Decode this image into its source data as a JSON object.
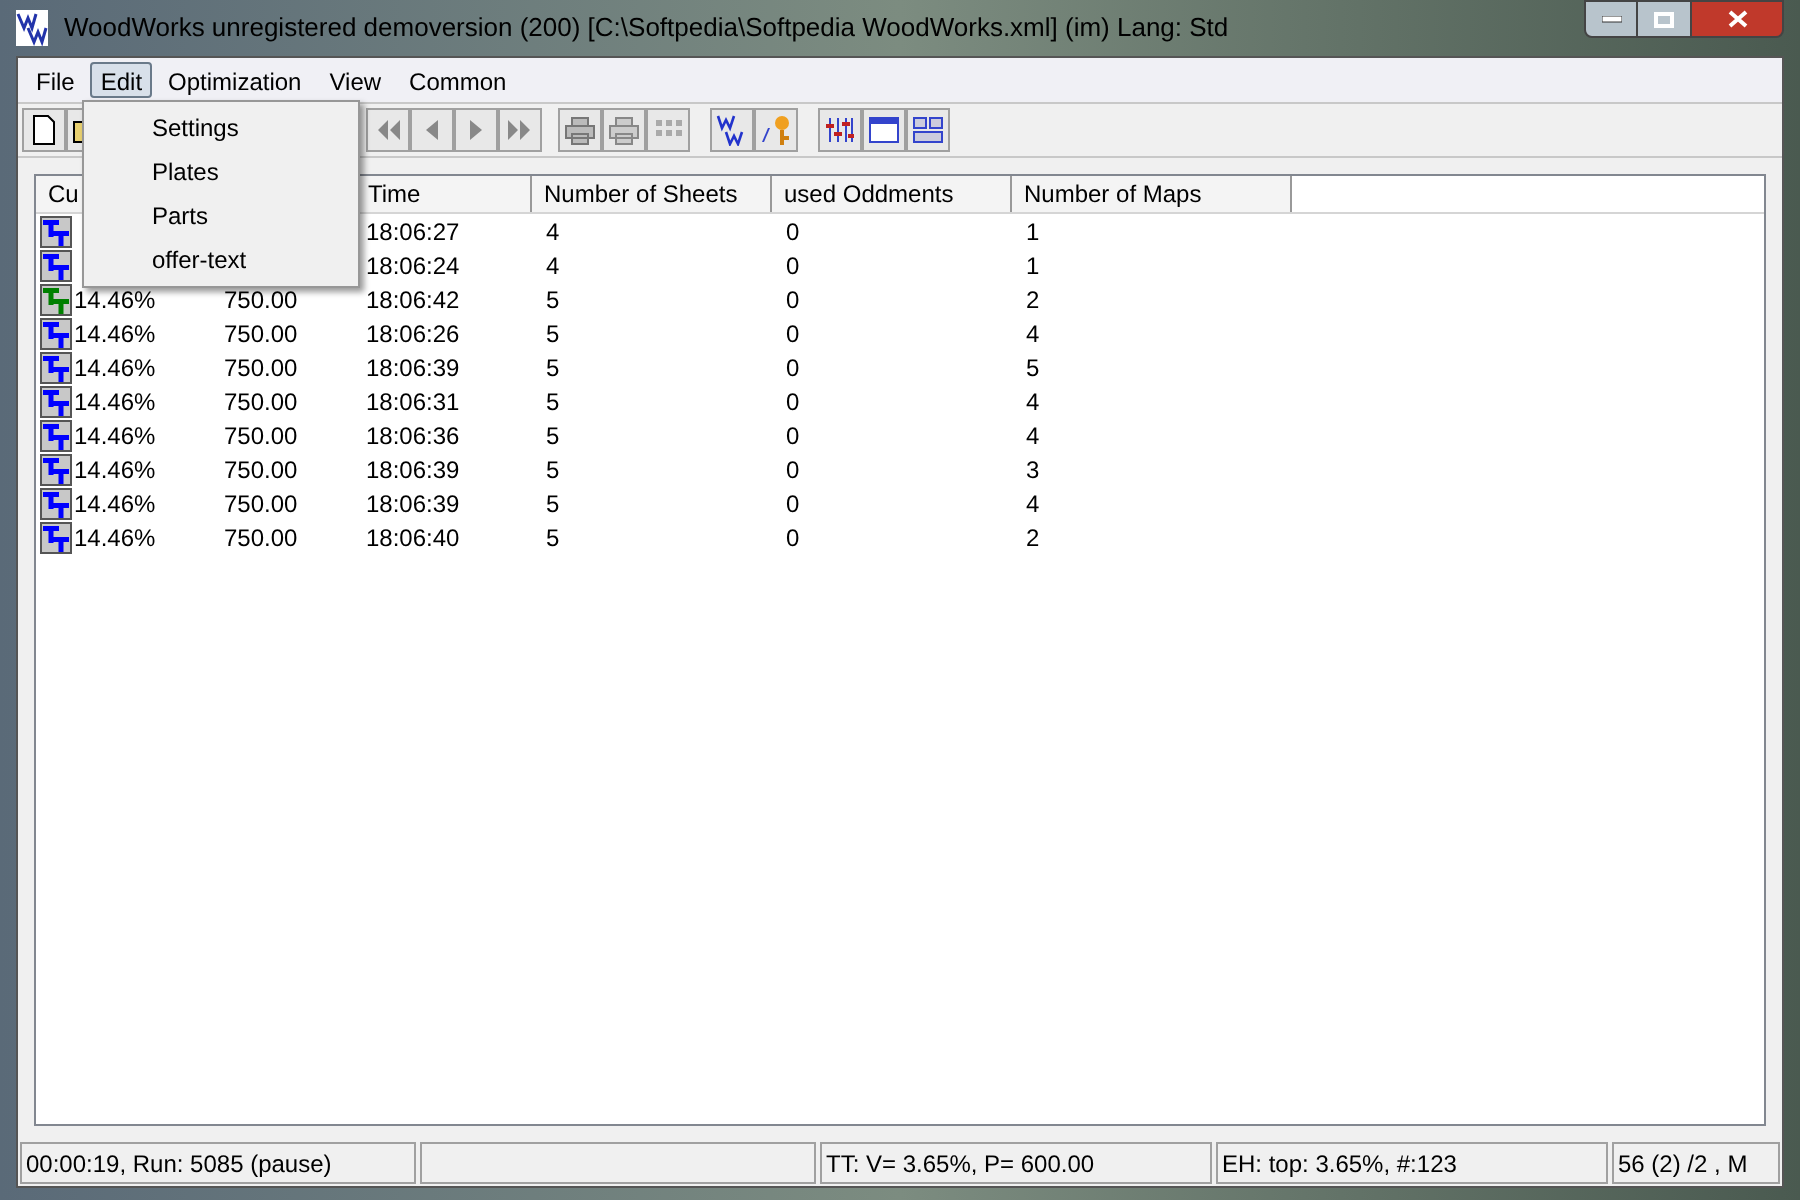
{
  "window": {
    "title": "WoodWorks unregistered demoversion (200) [C:\\Softpedia\\Softpedia WoodWorks.xml] (im) Lang: Std"
  },
  "menu": [
    {
      "label": "File",
      "selected": false
    },
    {
      "label": "Edit",
      "selected": true
    },
    {
      "label": "Optimization",
      "selected": false
    },
    {
      "label": "View",
      "selected": false
    },
    {
      "label": "Common",
      "selected": false
    }
  ],
  "dropdown": [
    "Settings",
    "Plates",
    "Parts",
    "offer-text"
  ],
  "table": {
    "columns": [
      {
        "label": "Cu"
      },
      {},
      {
        "label": "Time"
      },
      {
        "label": "Number of Sheets"
      },
      {
        "label": "used Oddments"
      },
      {
        "label": "Number of Maps"
      }
    ],
    "rows": [
      {
        "color": "#0000ff",
        "time": "18:06:27",
        "sheets": "4",
        "oddments": "0",
        "maps": "1"
      },
      {
        "color": "#0000ff",
        "time": "18:06:24",
        "sheets": "4",
        "oddments": "0",
        "maps": "1"
      },
      {
        "color": "#008000",
        "percent": "14.46%",
        "value": "750.00",
        "time": "18:06:42",
        "sheets": "5",
        "oddments": "0",
        "maps": "2"
      },
      {
        "color": "#0000ff",
        "percent": "14.46%",
        "value": "750.00",
        "time": "18:06:26",
        "sheets": "5",
        "oddments": "0",
        "maps": "4"
      },
      {
        "color": "#0000ff",
        "percent": "14.46%",
        "value": "750.00",
        "time": "18:06:39",
        "sheets": "5",
        "oddments": "0",
        "maps": "5"
      },
      {
        "color": "#0000ff",
        "percent": "14.46%",
        "value": "750.00",
        "time": "18:06:31",
        "sheets": "5",
        "oddments": "0",
        "maps": "4"
      },
      {
        "color": "#0000ff",
        "percent": "14.46%",
        "value": "750.00",
        "time": "18:06:36",
        "sheets": "5",
        "oddments": "0",
        "maps": "4"
      },
      {
        "color": "#0000ff",
        "percent": "14.46%",
        "value": "750.00",
        "time": "18:06:39",
        "sheets": "5",
        "oddments": "0",
        "maps": "3"
      },
      {
        "color": "#0000ff",
        "percent": "14.46%",
        "value": "750.00",
        "time": "18:06:39",
        "sheets": "5",
        "oddments": "0",
        "maps": "4"
      },
      {
        "color": "#0000ff",
        "percent": "14.46%",
        "value": "750.00",
        "time": "18:06:40",
        "sheets": "5",
        "oddments": "0",
        "maps": "2"
      }
    ]
  },
  "status_bar": [
    "00:00:19, Run: 5085 (pause)",
    "TT: V= 3.65%, P= 600.00",
    "EH: top: 3.65%,  #:123",
    "56 (2) /2 , M"
  ]
}
